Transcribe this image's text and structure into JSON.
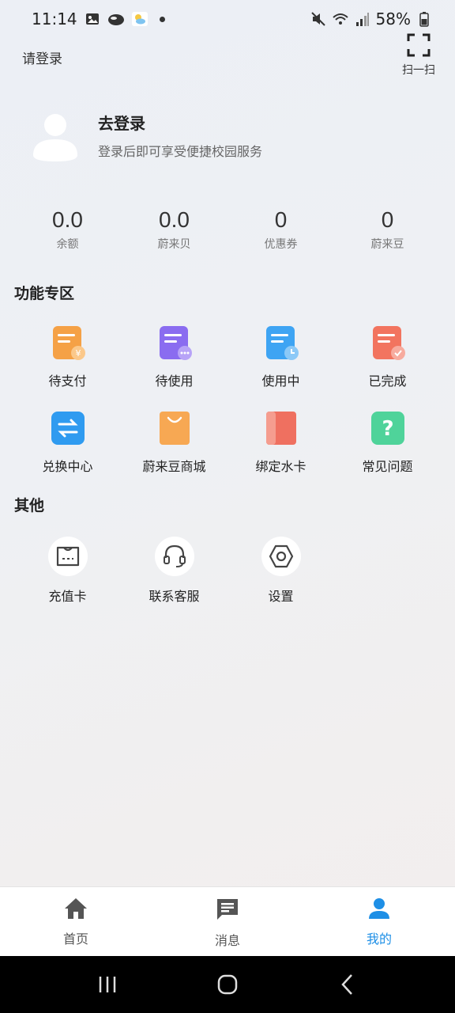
{
  "status_bar": {
    "time": "11:14",
    "battery": "58%",
    "icons": [
      "image-icon",
      "cloud-icon",
      "weather-icon",
      "mute-icon",
      "wifi-icon",
      "signal-icon",
      "battery-icon"
    ]
  },
  "header": {
    "login_link": "请登录",
    "scan_label": "扫一扫"
  },
  "profile": {
    "title": "去登录",
    "subtitle": "登录后即可享受便捷校园服务"
  },
  "stats": [
    {
      "value": "0.0",
      "label": "余额"
    },
    {
      "value": "0.0",
      "label": "蔚来贝"
    },
    {
      "value": "0",
      "label": "优惠券"
    },
    {
      "value": "0",
      "label": "蔚来豆"
    }
  ],
  "features": {
    "title": "功能专区",
    "items": [
      {
        "label": "待支付",
        "icon": "pending-payment-icon",
        "color": "#f5a146"
      },
      {
        "label": "待使用",
        "icon": "pending-use-icon",
        "color": "#8a6cf0"
      },
      {
        "label": "使用中",
        "icon": "in-use-icon",
        "color": "#3ea4f3"
      },
      {
        "label": "已完成",
        "icon": "completed-icon",
        "color": "#f2745f"
      },
      {
        "label": "兑换中心",
        "icon": "exchange-icon",
        "color": "#2f9bf0"
      },
      {
        "label": "蔚来豆商城",
        "icon": "shopping-bag-icon",
        "color": "#f7a853"
      },
      {
        "label": "绑定水卡",
        "icon": "water-card-icon",
        "color": "#ef7060"
      },
      {
        "label": "常见问题",
        "icon": "question-icon",
        "color": "#4fd39a"
      }
    ]
  },
  "other": {
    "title": "其他",
    "items": [
      {
        "label": "充值卡",
        "icon": "recharge-card-icon"
      },
      {
        "label": "联系客服",
        "icon": "headset-icon"
      },
      {
        "label": "设置",
        "icon": "settings-icon"
      }
    ]
  },
  "tabs": [
    {
      "label": "首页",
      "icon": "home-icon"
    },
    {
      "label": "消息",
      "icon": "message-icon"
    },
    {
      "label": "我的",
      "icon": "user-icon",
      "active": true
    }
  ],
  "colors": {
    "accent": "#1e8fe6",
    "text": "#222222",
    "muted": "#777777"
  }
}
